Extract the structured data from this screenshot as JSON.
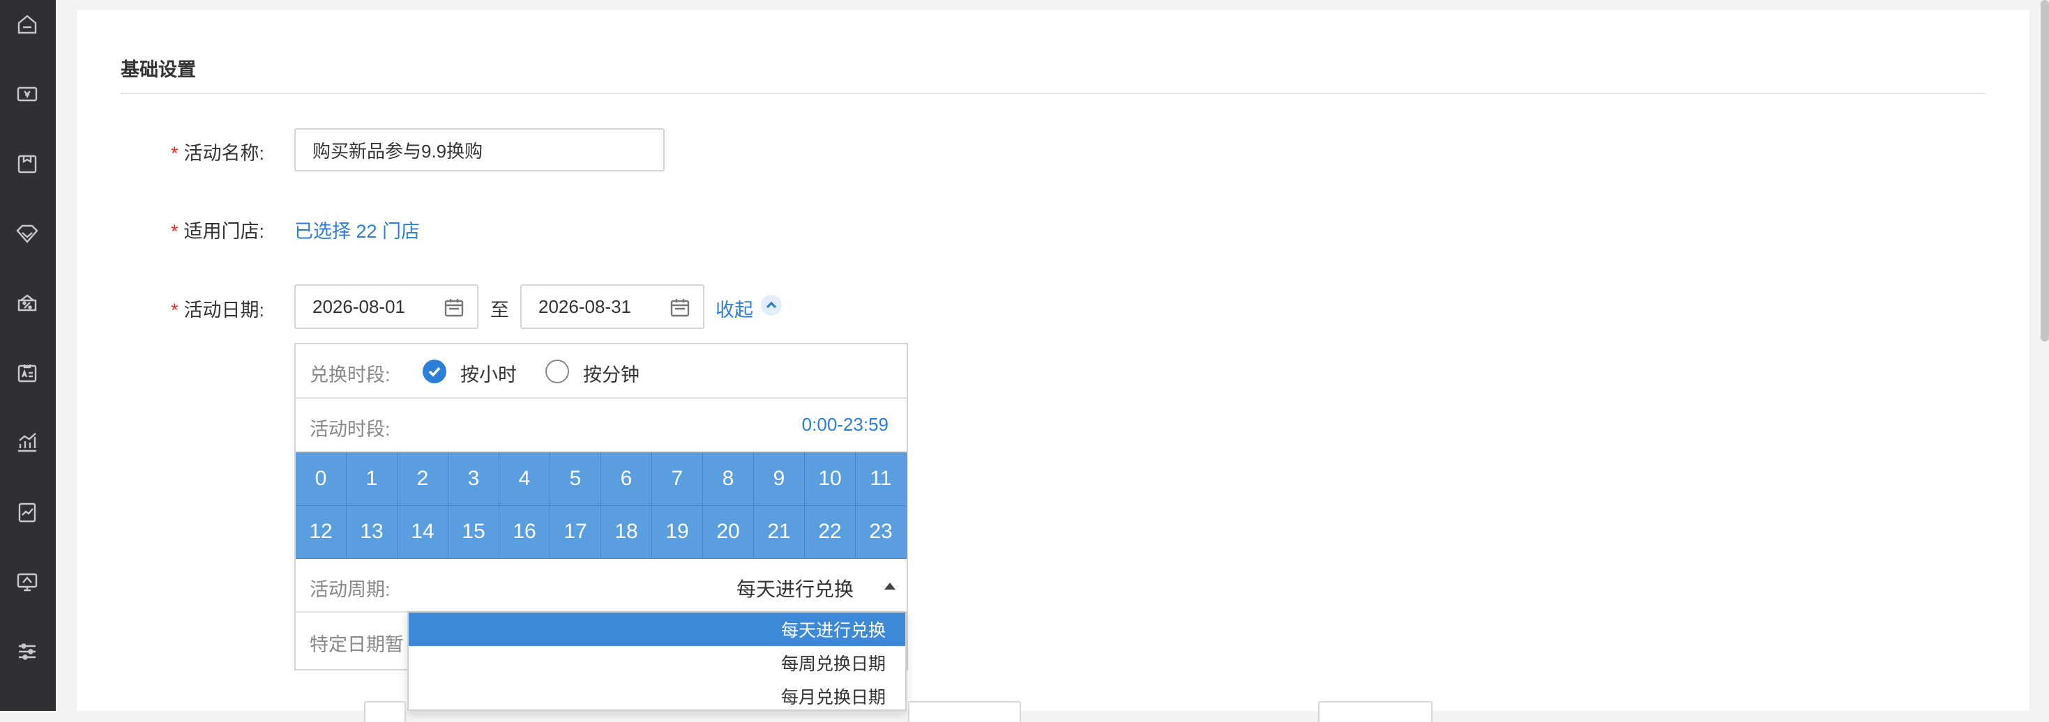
{
  "sidebar": {
    "icons": [
      "home-icon",
      "yen-card-icon",
      "box-icon",
      "diamond-icon",
      "coupon-icon",
      "id-card-icon",
      "chart-icon",
      "report-icon",
      "monitor-icon",
      "sliders-icon"
    ]
  },
  "section": {
    "title": "基础设置"
  },
  "form": {
    "activity_name": {
      "label": "活动名称:",
      "required": "*",
      "value": "购买新品参与9.9换购"
    },
    "stores": {
      "label": "适用门店:",
      "required": "*",
      "link": "已选择 22 门店"
    },
    "dates": {
      "label": "活动日期:",
      "required": "*",
      "start": "2026-08-01",
      "to": "至",
      "end": "2026-08-31",
      "collapse": "收起"
    }
  },
  "exchange": {
    "period_label": "兑换时段:",
    "option_hour": "按小时",
    "option_minute": "按分钟",
    "selected": "按小时",
    "time_label": "活动时段:",
    "time_value": "0:00-23:59",
    "hours": [
      "0",
      "1",
      "2",
      "3",
      "4",
      "5",
      "6",
      "7",
      "8",
      "9",
      "10",
      "11",
      "12",
      "13",
      "14",
      "15",
      "16",
      "17",
      "18",
      "19",
      "20",
      "21",
      "22",
      "23"
    ],
    "cycle_label": "活动周期:",
    "cycle_value": "每天进行兑换",
    "special_label": "特定日期暂"
  },
  "dropdown": {
    "options": [
      "每天进行兑换",
      "每周兑换日期",
      "每月兑换日期"
    ],
    "selected": "每天进行兑换"
  },
  "colors": {
    "accent": "#2d7ed6",
    "hour_cell": "#5a9ee0",
    "required": "#e0312b",
    "sidebar": "#2f3033"
  }
}
